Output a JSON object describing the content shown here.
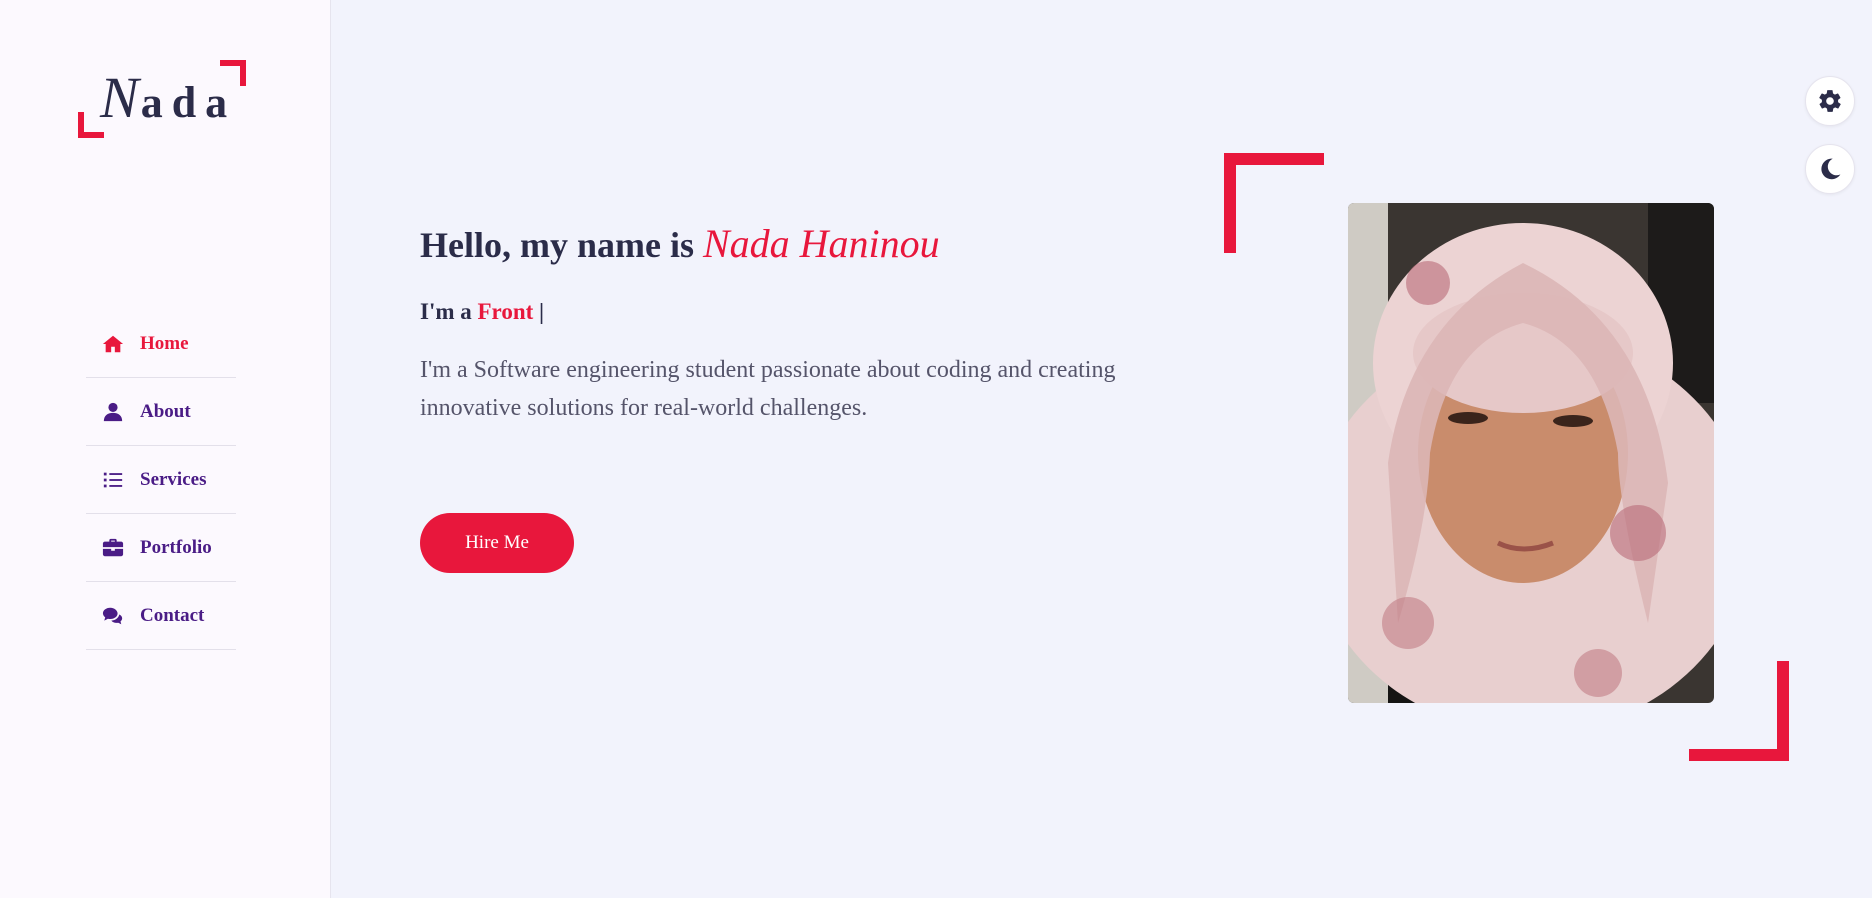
{
  "logo": {
    "first": "N",
    "rest": "ada"
  },
  "nav": {
    "items": [
      {
        "label": "Home",
        "icon": "home-icon",
        "active": true
      },
      {
        "label": "About",
        "icon": "user-icon"
      },
      {
        "label": "Services",
        "icon": "list-icon"
      },
      {
        "label": "Portfolio",
        "icon": "briefcase-icon"
      },
      {
        "label": "Contact",
        "icon": "comments-icon"
      }
    ]
  },
  "hero": {
    "greeting": "Hello, my name is",
    "name": "Nada Haninou",
    "typed_prefix": "I'm a",
    "typed_role": "Front",
    "typed_cursor": "|",
    "description": "I'm a Software engineering student passionate about coding and creating innovative solutions for real-world challenges.",
    "cta": "Hire Me"
  },
  "controls": {
    "settings_icon": "gear-icon",
    "theme_icon": "moon-icon"
  },
  "colors": {
    "accent": "#e8173c",
    "nav": "#4a1c86",
    "text": "#2b2c49",
    "background": "#f2f3fc"
  }
}
